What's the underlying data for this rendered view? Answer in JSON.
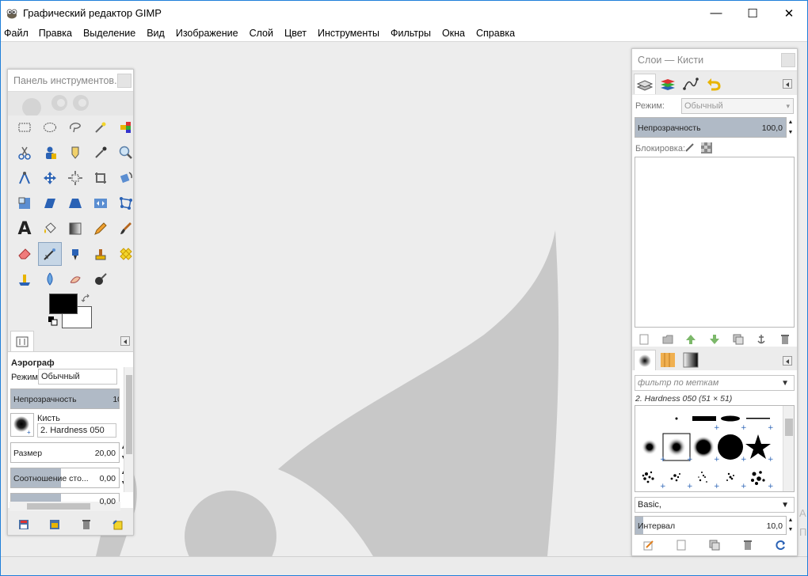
{
  "window": {
    "title": "Графический редактор GIMP",
    "minimize": "—",
    "maximize": "☐",
    "close": "✕"
  },
  "menu": [
    "Файл",
    "Правка",
    "Выделение",
    "Вид",
    "Изображение",
    "Слой",
    "Цвет",
    "Инструменты",
    "Фильтры",
    "Окна",
    "Справка"
  ],
  "toolbox": {
    "title": "Панель инструментов...",
    "tools": [
      {
        "name": "rect-select-icon"
      },
      {
        "name": "ellipse-select-icon"
      },
      {
        "name": "free-select-icon"
      },
      {
        "name": "fuzzy-select-icon"
      },
      {
        "name": "select-by-color-icon"
      },
      {
        "name": "scissors-select-icon"
      },
      {
        "name": "foreground-select-icon"
      },
      {
        "name": "paths-icon"
      },
      {
        "name": "color-picker-icon"
      },
      {
        "name": "zoom-icon"
      },
      {
        "name": "measure-icon"
      },
      {
        "name": "move-icon"
      },
      {
        "name": "align-icon"
      },
      {
        "name": "crop-icon"
      },
      {
        "name": "rotate-icon"
      },
      {
        "name": "scale-icon"
      },
      {
        "name": "shear-icon"
      },
      {
        "name": "perspective-icon"
      },
      {
        "name": "flip-icon"
      },
      {
        "name": "cage-transform-icon"
      },
      {
        "name": "text-icon"
      },
      {
        "name": "bucket-fill-icon"
      },
      {
        "name": "blend-icon"
      },
      {
        "name": "pencil-icon"
      },
      {
        "name": "paintbrush-icon"
      },
      {
        "name": "eraser-icon"
      },
      {
        "name": "airbrush-icon"
      },
      {
        "name": "ink-icon"
      },
      {
        "name": "clone-icon"
      },
      {
        "name": "heal-icon"
      },
      {
        "name": "perspective-clone-icon"
      },
      {
        "name": "blur-icon"
      },
      {
        "name": "smudge-icon"
      },
      {
        "name": "dodge-burn-icon"
      }
    ],
    "text_tool_glyph": "A",
    "options": {
      "heading": "Аэрограф",
      "mode_label": "Режим:",
      "mode_value": "Обычный",
      "opacity_label": "Непрозрачность",
      "opacity_value": "10",
      "brush_label": "Кисть",
      "brush_value": "2. Hardness 050",
      "size_label": "Размер",
      "size_value": "20,00",
      "aspect_label": "Соотношение сто...",
      "aspect_value": "0,00",
      "partial_value": "0,00"
    }
  },
  "dock": {
    "title": "Слои — Кисти",
    "mode_label": "Режим:",
    "mode_value": "Обычный",
    "opacity_label": "Непрозрачность",
    "opacity_value": "100,0",
    "opacity_fraction": 1.0,
    "lock_label": "Блокировка:",
    "brush_filter_placeholder": "фильтр по меткам",
    "brush_selected": "2. Hardness 050 (51 × 51)",
    "brush_set": "Basic,",
    "spacing_label": "Интервал",
    "spacing_value": "10,0",
    "spacing_fraction": 0.05
  },
  "watermark": [
    "A",
    "П"
  ]
}
